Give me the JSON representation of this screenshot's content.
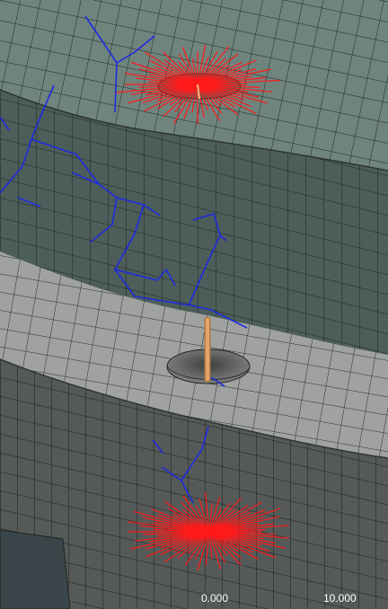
{
  "viewport": {
    "scale_bar": {
      "label_start": "0.000",
      "label_end": "10.000"
    }
  },
  "colors": {
    "top_ring_face": "#6f847d",
    "top_ring_side": "#4d5d59",
    "bottom_ring_face": "#9fa2a0",
    "bottom_ring_side": "#555a58",
    "mesh_line": "#1e2623",
    "spider_lines": "#ff1a1a",
    "path_lines": "#1f2be0",
    "rod": "#e2a66a"
  },
  "icons": [
    "mesh-geometry",
    "rbe-spider-icon",
    "beam-element-icon"
  ]
}
